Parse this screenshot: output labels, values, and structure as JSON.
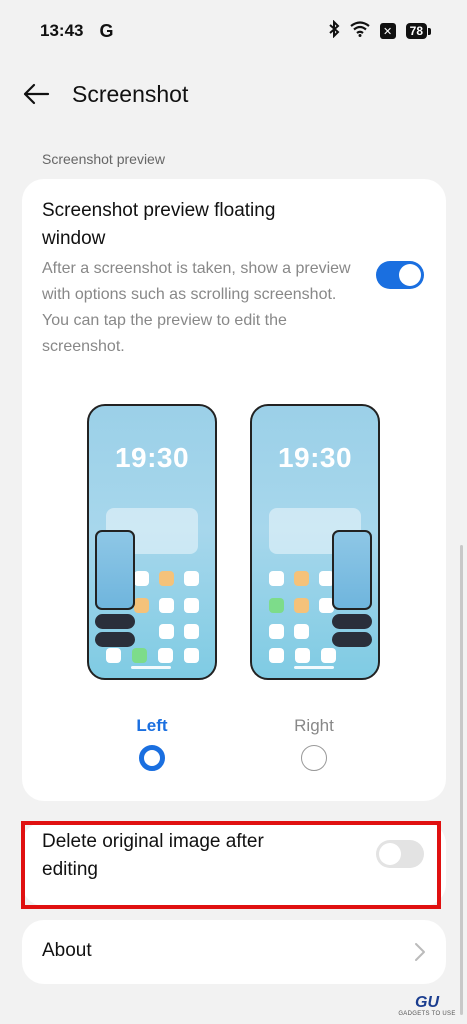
{
  "status_bar": {
    "time": "13:43",
    "carrier_icon": "google-g-icon",
    "icons": [
      "bluetooth-icon",
      "wifi-icon",
      "x-badge-icon",
      "battery-icon"
    ],
    "x_badge": "✕",
    "battery": "78"
  },
  "header": {
    "back_icon": "arrow-left-icon",
    "title": "Screenshot"
  },
  "section": {
    "label": "Screenshot preview"
  },
  "floating_window": {
    "title": "Screenshot preview floating window",
    "description": "After a screenshot is taken, show a preview with options such as scrolling screenshot. You can tap the preview to edit the screenshot.",
    "enabled": true
  },
  "preview": {
    "left_clock": "19:30",
    "right_clock": "19:30",
    "options": [
      {
        "label": "Left",
        "selected": true
      },
      {
        "label": "Right",
        "selected": false
      }
    ]
  },
  "delete_original": {
    "title": "Delete original image after editing",
    "enabled": false
  },
  "about": {
    "title": "About",
    "icon": "chevron-right-icon"
  },
  "colors": {
    "accent": "#1a6fe0",
    "highlight": "#e01010",
    "app_orange": "#f5c27a",
    "app_green": "#7ddc8a"
  },
  "watermark": {
    "logo": "GU",
    "text": "GADGETS TO USE"
  }
}
